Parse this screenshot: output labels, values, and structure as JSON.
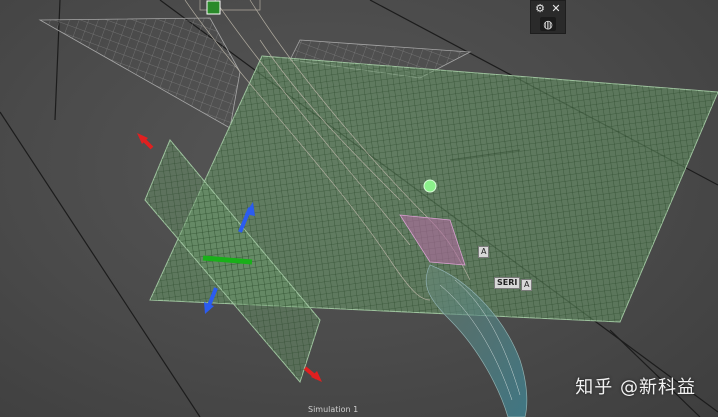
{
  "toolbar": {
    "gear_icon": "⚙",
    "close_icon": "✕",
    "globe_icon": "◍"
  },
  "tags": {
    "a": "A",
    "b": "SERI",
    "c": "A"
  },
  "status": {
    "simulation_label": "Simulation 1"
  },
  "watermark": {
    "text": "知乎 @新科益"
  },
  "colors": {
    "plane_fill": "#6fa06f",
    "mesh_line": "#1e3a1e",
    "arrow_red": "#e02020",
    "arrow_blue": "#2b5cf0",
    "arrow_green": "#19b019"
  }
}
